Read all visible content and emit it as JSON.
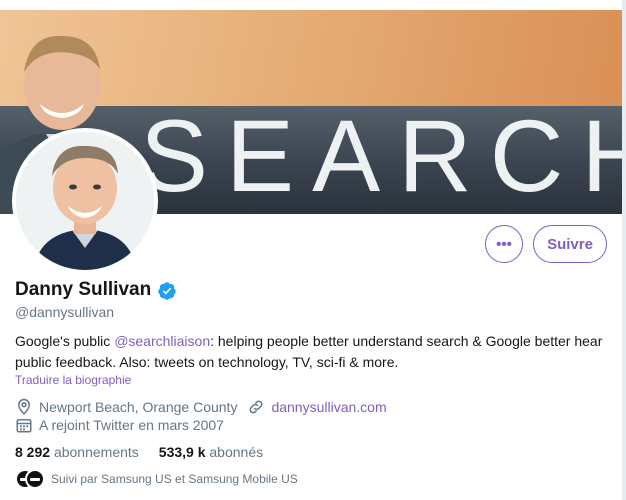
{
  "banner": {
    "word": "SEARCH"
  },
  "profile": {
    "name": "Danny Sullivan",
    "handle": "@dannysullivan",
    "bio_before": "Google's public ",
    "bio_mention": "@searchliaison",
    "bio_after": ": helping people better understand search & Google better hear public feedback. Also: tweets on technology, TV, sci-fi & more.",
    "translate_label": "Traduire la biographie",
    "location": "Newport Beach, Orange County",
    "website": "dannysullivan.com",
    "joined": "A rejoint Twitter en mars 2007"
  },
  "actions": {
    "more_label": "•••",
    "follow_label": "Suivre"
  },
  "stats": {
    "following_count": "8 292",
    "following_label": "abonnements",
    "followers_count": "533,9 k",
    "followers_label": "abonnés"
  },
  "followed_by": {
    "text": "Suivi par Samsung US et Samsung Mobile US"
  },
  "icons": {
    "verified": "verified-badge-icon",
    "location": "location-pin-icon",
    "link": "link-icon",
    "calendar": "calendar-icon"
  },
  "colors": {
    "accent": "#7f5fbf",
    "verified": "#1da1f2",
    "secondary_text": "#657786",
    "primary_text": "#14171a"
  }
}
